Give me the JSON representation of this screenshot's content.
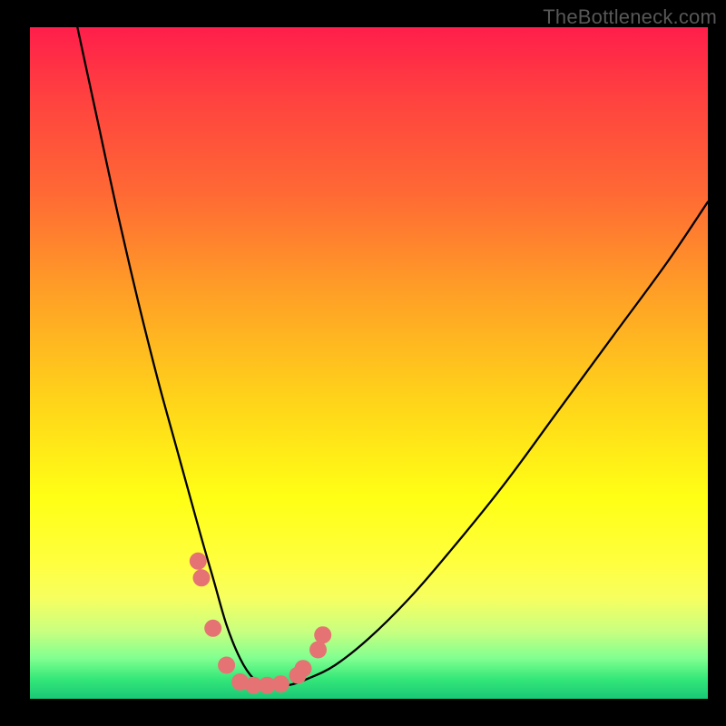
{
  "watermark": "TheBottleneck.com",
  "colors": {
    "frame": "#000000",
    "gradient_top": "#ff1e4b",
    "gradient_mid": "#ffff15",
    "gradient_bottom": "#19c876",
    "curve": "#000000",
    "dots": "#e57373"
  },
  "chart_data": {
    "type": "line",
    "title": "",
    "xlabel": "",
    "ylabel": "",
    "xlim": [
      0,
      100
    ],
    "ylim": [
      0,
      100
    ],
    "grid": false,
    "legend": false,
    "series": [
      {
        "name": "bottleneck-curve",
        "x": [
          7,
          10,
          13,
          16,
          19,
          22,
          25,
          27,
          29,
          31,
          33,
          35,
          38,
          41,
          45,
          50,
          56,
          62,
          70,
          78,
          86,
          94,
          100
        ],
        "y": [
          100,
          86,
          72,
          59,
          47,
          36,
          25,
          18,
          11,
          6,
          3,
          2,
          2,
          3,
          5,
          9,
          15,
          22,
          32,
          43,
          54,
          65,
          74
        ]
      }
    ],
    "highlight_points": {
      "name": "highlighted-dots",
      "x": [
        24.8,
        25.3,
        27.0,
        29.0,
        31.0,
        33.0,
        35.0,
        37.0,
        39.5,
        40.3,
        42.5,
        43.2
      ],
      "y": [
        20.5,
        18.0,
        10.5,
        5.0,
        2.5,
        2.0,
        2.0,
        2.2,
        3.5,
        4.5,
        7.3,
        9.5
      ]
    }
  }
}
